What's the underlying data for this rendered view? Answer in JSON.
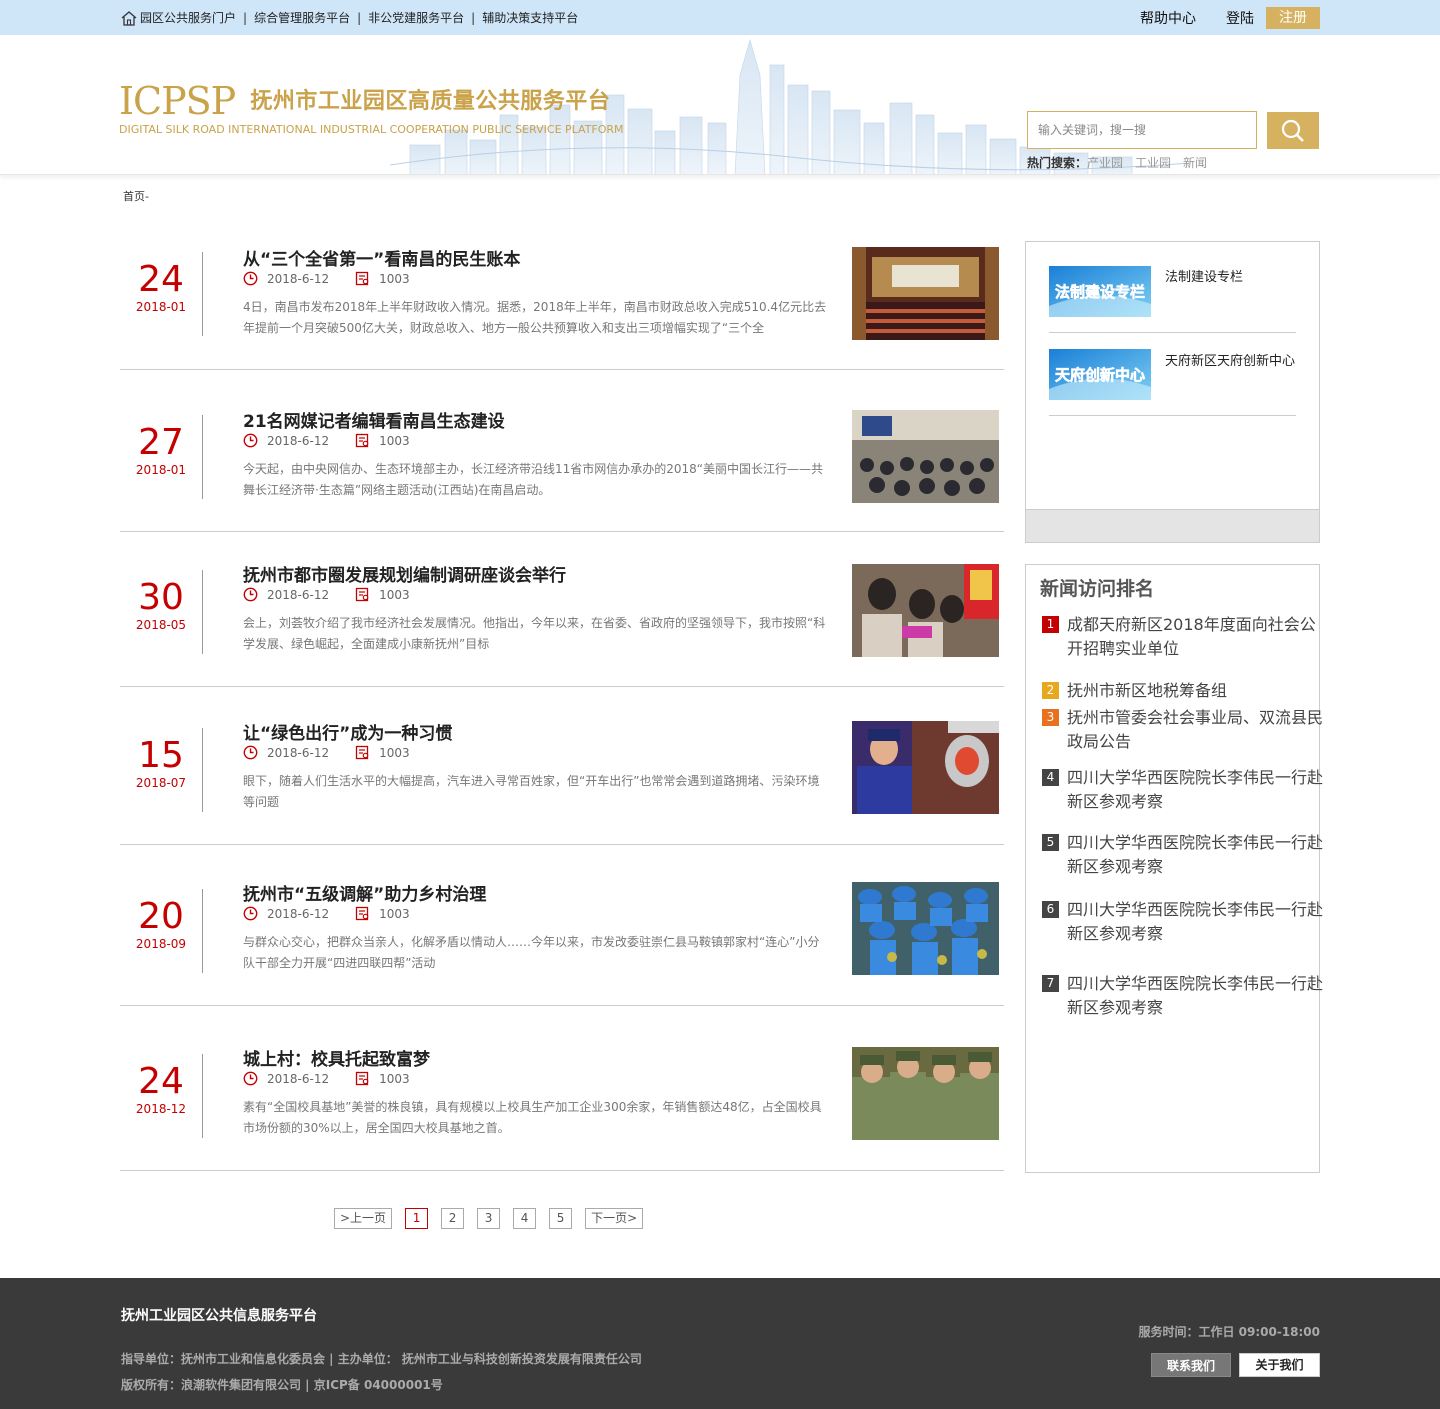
{
  "topbar": {
    "links": [
      "园区公共服务门户",
      "综合管理服务平台",
      "非公党建服务平台",
      "辅助决策支持平台"
    ],
    "help": "帮助中心",
    "login": "登陆",
    "register": "注册"
  },
  "brand": {
    "logo": "ICPSP",
    "title": "抚州市工业园区高质量公共服务平台",
    "subtitle": "DIGITAL SILK ROAD INTERNATIONAL INDUSTRIAL COOPERATION PUBLIC SERVICE PLATFORM"
  },
  "search": {
    "placeholder": "输入关键词，搜一搜",
    "hot_label": "热门搜索：",
    "hot_terms": [
      "产业园",
      "工业园",
      "新闻"
    ]
  },
  "breadcrumb": "首页-",
  "articles": [
    {
      "day": "24",
      "ym": "2018-01",
      "title": "从“三个全省第一”看南昌的民生账本",
      "date": "2018-6-12",
      "views": "1003",
      "desc": "4日，南昌市发布2018年上半年财政收入情况。据悉，2018年上半年，南昌市财政总收入完成510.4亿元比去年提前一个月突破500亿大关，财政总收入、地方一般公共预算收入和支出三项增幅实现了“三个全"
    },
    {
      "day": "27",
      "ym": "2018-01",
      "title": "21名网媒记者编辑看南昌生态建设",
      "date": "2018-6-12",
      "views": "1003",
      "desc": "今天起，由中央网信办、生态环境部主办，长江经济带沿线11省市网信办承办的2018“美丽中国长江行——共舞长江经济带·生态篇”网络主题活动(江西站)在南昌启动。"
    },
    {
      "day": "30",
      "ym": "2018-05",
      "title": "抚州市都市圈发展规划编制调研座谈会举行",
      "date": "2018-6-12",
      "views": "1003",
      "desc": "会上，刘荟牧介绍了我市经济社会发展情况。他指出，今年以来，在省委、省政府的坚强领导下，我市按照“科学发展、绿色崛起，全面建成小康新抚州”目标"
    },
    {
      "day": "15",
      "ym": "2018-07",
      "title": "让“绿色出行”成为一种习惯",
      "date": "2018-6-12",
      "views": "1003",
      "desc": "眼下，随着人们生活水平的大幅提高，汽车进入寻常百姓家，但“开车出行”也常常会遇到道路拥堵、污染环境等问题"
    },
    {
      "day": "20",
      "ym": "2018-09",
      "title": "抚州市“五级调解”助力乡村治理",
      "date": "2018-6-12",
      "views": "1003",
      "desc": "与群众心交心，把群众当亲人，化解矛盾以情动人……今年以来，市发改委驻崇仁县马鞍镇郭家村“连心”小分队干部全力开展“四进四联四帮”活动"
    },
    {
      "day": "24",
      "ym": "2018-12",
      "title": "城上村：校具托起致富梦",
      "date": "2018-6-12",
      "views": "1003",
      "desc": "素有“全国校具基地”美誉的株良镇，具有规模以上校具生产加工企业300余家，年销售额达48亿，占全国校具市场份额的30%以上，居全国四大校具基地之首。"
    }
  ],
  "pager": {
    "prev": ">上一页",
    "pages": [
      "1",
      "2",
      "3",
      "4",
      "5"
    ],
    "next": "下一页>"
  },
  "side_links": [
    {
      "img_text": "法制建设专栏",
      "label": "法制建设专栏"
    },
    {
      "img_text": "天府创新中心",
      "label": "天府新区天府创新中心"
    }
  ],
  "ranking": {
    "title": "新闻访问排名",
    "colors": [
      "#c40000",
      "#e8a81e",
      "#e8701e",
      "#444444",
      "#444444",
      "#444444",
      "#444444"
    ],
    "items": [
      {
        "num": "1",
        "text": "成都天府新区2018年度面向社会公开招聘实业单位"
      },
      {
        "num": "2",
        "text": "抚州市新区地税筹备组"
      },
      {
        "num": "3",
        "text": "抚州市管委会社会事业局、双流县民政局公告"
      },
      {
        "num": "4",
        "text": "四川大学华西医院院长李伟民一行赴新区参观考察"
      },
      {
        "num": "5",
        "text": "四川大学华西医院院长李伟民一行赴新区参观考察"
      },
      {
        "num": "6",
        "text": "四川大学华西医院院长李伟民一行赴新区参观考察"
      },
      {
        "num": "7",
        "text": "四川大学华西医院院长李伟民一行赴新区参观考察"
      }
    ]
  },
  "footer": {
    "title": "抚州工业园区公共信息服务平台",
    "line1": "指导单位：抚州市工业和信息化委员会 | 主办单位： 抚州市工业与科技创新投资发展有限责任公司",
    "line2": "版权所有：浪潮软件集团有限公司 | 京ICP备 04000001号",
    "service": "服务时间：工作日  09:00-18:00",
    "contact": "联系我们",
    "about": "关于我们"
  }
}
